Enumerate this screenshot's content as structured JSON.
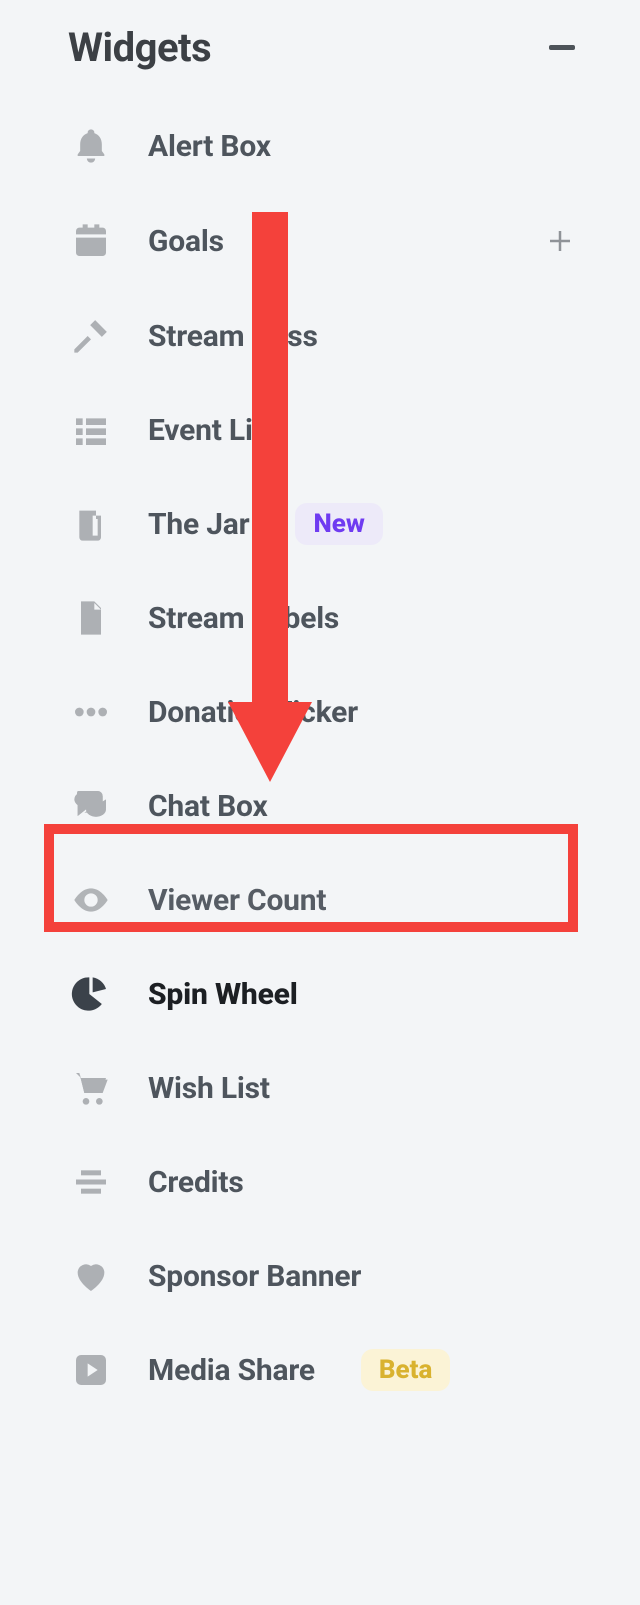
{
  "header": {
    "title": "Widgets"
  },
  "badges": {
    "new": "New",
    "beta": "Beta"
  },
  "items": [
    {
      "label": "Alert Box"
    },
    {
      "label": "Goals"
    },
    {
      "label": "Stream Boss"
    },
    {
      "label": "Event List"
    },
    {
      "label": "The Jar"
    },
    {
      "label": "Stream Labels"
    },
    {
      "label": "Donation Ticker"
    },
    {
      "label": "Chat Box"
    },
    {
      "label": "Viewer Count"
    },
    {
      "label": "Spin Wheel"
    },
    {
      "label": "Wish List"
    },
    {
      "label": "Credits"
    },
    {
      "label": "Sponsor Banner"
    },
    {
      "label": "Media Share"
    }
  ],
  "annotation": {
    "highlight_item_index": 7
  }
}
